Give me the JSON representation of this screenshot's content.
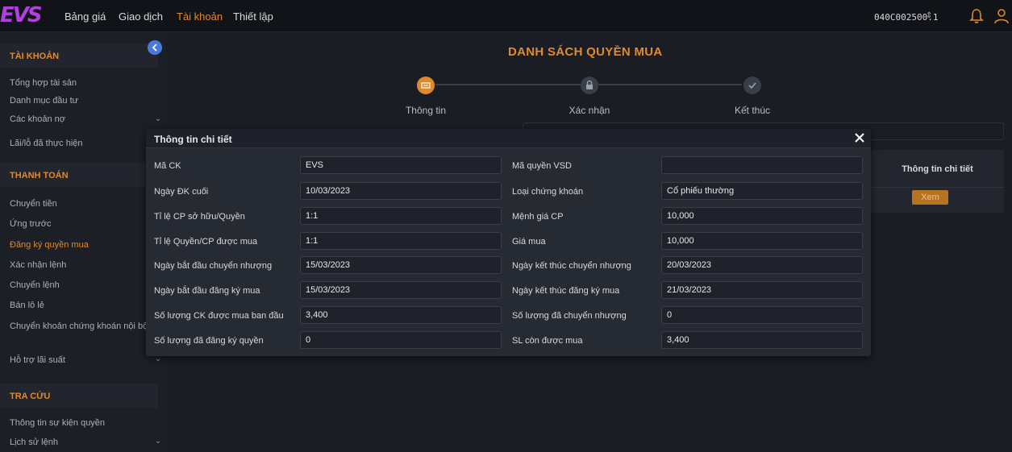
{
  "topbar": {
    "logo": "EVS",
    "nav": [
      "Bảng giá",
      "Giao dịch",
      "Tài khoản",
      "Thiết lập"
    ],
    "active_nav": "Tài khoản",
    "account": "040C002500.1",
    "accent": "#e08a2c"
  },
  "sidebar": {
    "sections": [
      {
        "title": "TÀI KHOẢN",
        "items": [
          "Tổng hợp tài sản",
          "Danh mục đầu tư",
          "Các khoản nợ",
          "Lãi/lỗ đã thực hiện"
        ]
      },
      {
        "title": "THANH TOÁN",
        "items": [
          "Chuyển tiền",
          "Ứng trước",
          "Đăng ký quyền mua",
          "Xác nhận lệnh",
          "Chuyển lệnh",
          "Bán lô lẻ",
          "Chuyển khoản chứng khoán nội bộ",
          "Hỗ trợ lãi suất"
        ]
      },
      {
        "title": "TRA CỨU",
        "items": [
          "Thông tin sự kiện quyền",
          "Lịch sử lệnh"
        ]
      }
    ],
    "active_item": "Đăng ký quyền mua"
  },
  "main": {
    "title": "DANH SÁCH QUYỀN MUA",
    "steps": [
      "Thông tin",
      "Xác nhận",
      "Kết thúc"
    ],
    "active_step": 0,
    "right_table": {
      "header": "Thông tin chi tiết",
      "button": "Xem"
    }
  },
  "modal": {
    "title": "Thông tin chi tiết",
    "left_fields": [
      {
        "label": "Mã CK",
        "value": "EVS"
      },
      {
        "label": "Ngày ĐK cuối",
        "value": "10/03/2023"
      },
      {
        "label": "Tỉ lệ CP sở hữu/Quyền",
        "value": "1:1"
      },
      {
        "label": "Tỉ lệ Quyền/CP được mua",
        "value": "1:1"
      },
      {
        "label": "Ngày bắt đầu chuyển nhượng",
        "value": "15/03/2023"
      },
      {
        "label": "Ngày bắt đầu đăng ký mua",
        "value": "15/03/2023"
      },
      {
        "label": "Số lượng CK được mua ban đầu",
        "value": "3,400"
      },
      {
        "label": "Số lượng đã đăng ký quyền",
        "value": "0"
      }
    ],
    "right_fields": [
      {
        "label": "Mã quyền VSD",
        "value": ""
      },
      {
        "label": "Loại chứng khoán",
        "value": "Cổ phiếu thường"
      },
      {
        "label": "Mệnh giá CP",
        "value": "10,000"
      },
      {
        "label": "Giá mua",
        "value": "10,000"
      },
      {
        "label": "Ngày kết thúc chuyển nhượng",
        "value": "20/03/2023"
      },
      {
        "label": "Ngày kết thúc đăng ký mua",
        "value": "21/03/2023"
      },
      {
        "label": "Số lượng đã chuyển nhượng",
        "value": "0"
      },
      {
        "label": "SL còn được mua",
        "value": "3,400"
      }
    ]
  }
}
